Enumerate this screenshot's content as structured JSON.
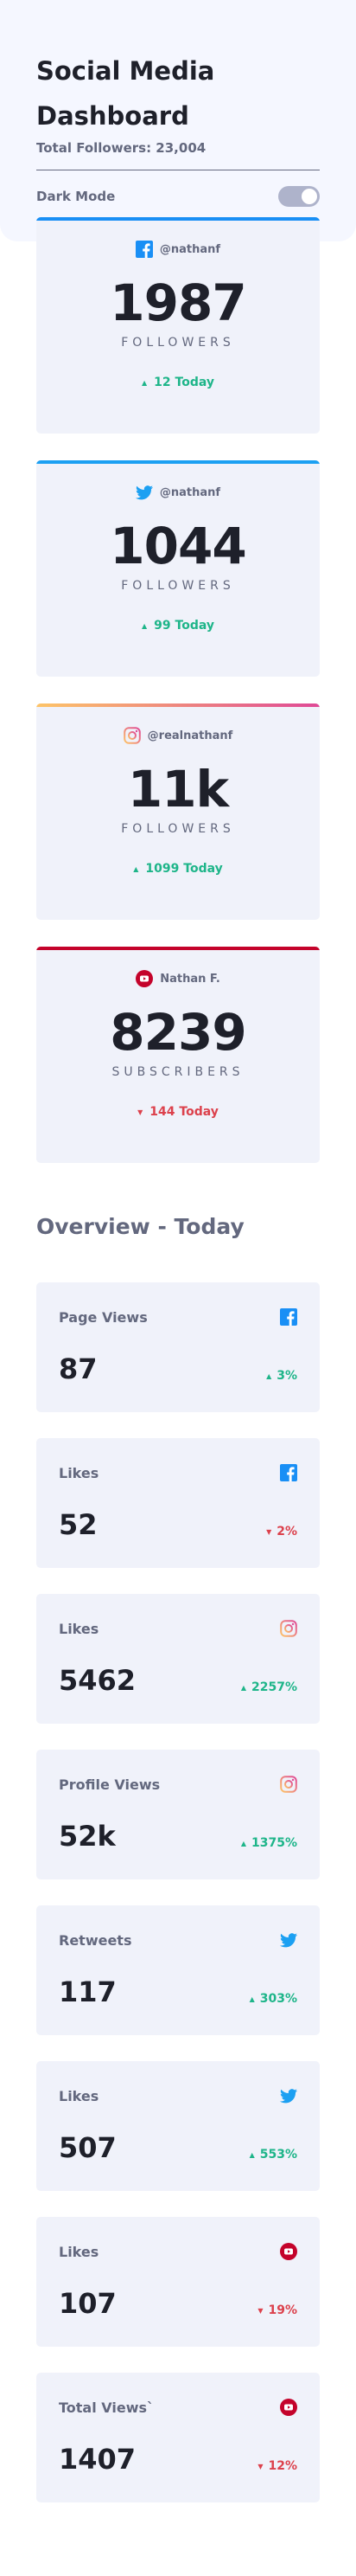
{
  "header": {
    "title": "Social Media Dashboard",
    "total_followers": "Total Followers: 23,004",
    "dark_mode_label": "Dark Mode"
  },
  "colors": {
    "facebook": "#198ff5",
    "twitter": "#1ca0f2",
    "instagram_gradient_start": "#fdc468",
    "instagram_gradient_end": "#df4996",
    "youtube": "#c4032b",
    "up": "#1eb589",
    "down": "#dc414c"
  },
  "followers": [
    {
      "platform": "facebook",
      "icon": "facebook-icon",
      "handle": "@nathanf",
      "count": "1987",
      "unit": "FOLLOWERS",
      "delta": "12 Today",
      "direction": "up"
    },
    {
      "platform": "twitter",
      "icon": "twitter-icon",
      "handle": "@nathanf",
      "count": "1044",
      "unit": "FOLLOWERS",
      "delta": "99 Today",
      "direction": "up"
    },
    {
      "platform": "instagram",
      "icon": "instagram-icon",
      "handle": "@realnathanf",
      "count": "11k",
      "unit": "FOLLOWERS",
      "delta": "1099 Today",
      "direction": "up"
    },
    {
      "platform": "youtube",
      "icon": "youtube-icon",
      "handle": "Nathan F.",
      "count": "8239",
      "unit": "SUBSCRIBERS",
      "delta": "144 Today",
      "direction": "down"
    }
  ],
  "overview": {
    "title": "Overview - Today",
    "items": [
      {
        "label": "Page Views",
        "platform": "facebook",
        "icon": "facebook-icon",
        "value": "87",
        "delta": "3%",
        "direction": "up"
      },
      {
        "label": "Likes",
        "platform": "facebook",
        "icon": "facebook-icon",
        "value": "52",
        "delta": "2%",
        "direction": "down"
      },
      {
        "label": "Likes",
        "platform": "instagram",
        "icon": "instagram-icon",
        "value": "5462",
        "delta": "2257%",
        "direction": "up"
      },
      {
        "label": "Profile Views",
        "platform": "instagram",
        "icon": "instagram-icon",
        "value": "52k",
        "delta": "1375%",
        "direction": "up"
      },
      {
        "label": "Retweets",
        "platform": "twitter",
        "icon": "twitter-icon",
        "value": "117",
        "delta": "303%",
        "direction": "up"
      },
      {
        "label": "Likes",
        "platform": "twitter",
        "icon": "twitter-icon",
        "value": "507",
        "delta": "553%",
        "direction": "up"
      },
      {
        "label": "Likes",
        "platform": "youtube",
        "icon": "youtube-icon",
        "value": "107",
        "delta": "19%",
        "direction": "down"
      },
      {
        "label": "Total Views`",
        "platform": "youtube",
        "icon": "youtube-icon",
        "value": "1407",
        "delta": "12%",
        "direction": "down"
      }
    ]
  }
}
